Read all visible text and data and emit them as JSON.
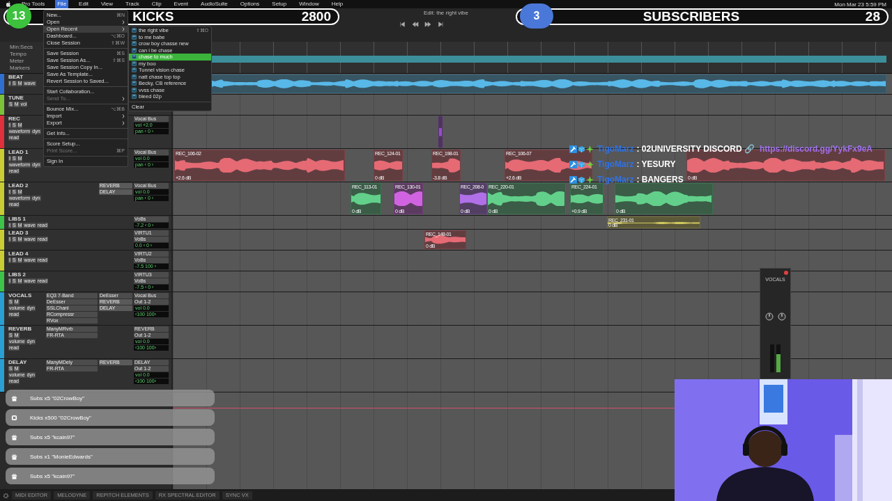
{
  "menu_bar": {
    "items": [
      {
        "label": "Pro Tools",
        "selected": false
      },
      {
        "label": "File",
        "selected": true
      },
      {
        "label": "Edit",
        "selected": false
      },
      {
        "label": "View",
        "selected": false
      },
      {
        "label": "Track",
        "selected": false
      },
      {
        "label": "Clip",
        "selected": false
      },
      {
        "label": "Event",
        "selected": false
      },
      {
        "label": "AudioSuite",
        "selected": false
      },
      {
        "label": "Options",
        "selected": false
      },
      {
        "label": "Setup",
        "selected": false
      },
      {
        "label": "Window",
        "selected": false
      },
      {
        "label": "Help",
        "selected": false
      }
    ],
    "clock": "Mon Mar 23  5:59 PM"
  },
  "window": {
    "title": "Edit: the right vibe"
  },
  "stream_counters": [
    {
      "badge": "13",
      "label": "KICKS",
      "value": "2800",
      "color": "#3cc23c"
    },
    {
      "badge": "3",
      "label": "SUBSCRIBERS",
      "value": "28",
      "color": "#4a78d8"
    }
  ],
  "file_menu": [
    {
      "kind": "item",
      "label": "New...",
      "shortcut": "⌘N",
      "submenu": false,
      "disabled": false,
      "selected": false
    },
    {
      "kind": "item",
      "label": "Open",
      "submenu": true,
      "disabled": false,
      "selected": false
    },
    {
      "kind": "item",
      "label": "Open Recent",
      "submenu": true,
      "disabled": false,
      "selected": true
    },
    {
      "kind": "item",
      "label": "Dashboard...",
      "shortcut": "⌥⌘O",
      "submenu": false,
      "disabled": false,
      "selected": false
    },
    {
      "kind": "item",
      "label": "Close Session",
      "shortcut": "⇧⌘W",
      "submenu": false,
      "disabled": false,
      "selected": false
    },
    {
      "kind": "separator"
    },
    {
      "kind": "item",
      "label": "Save Session",
      "shortcut": "⌘S",
      "submenu": false,
      "disabled": false,
      "selected": false
    },
    {
      "kind": "item",
      "label": "Save Session As...",
      "shortcut": "⇧⌘S",
      "submenu": false,
      "disabled": false,
      "selected": false
    },
    {
      "kind": "item",
      "label": "Save Session Copy In...",
      "submenu": false,
      "disabled": false,
      "selected": false
    },
    {
      "kind": "item",
      "label": "Save As Template...",
      "submenu": false,
      "disabled": false,
      "selected": false
    },
    {
      "kind": "item",
      "label": "Revert Session to Saved...",
      "submenu": false,
      "disabled": false,
      "selected": false
    },
    {
      "kind": "separator"
    },
    {
      "kind": "item",
      "label": "Start Collaboration...",
      "submenu": false,
      "disabled": false,
      "selected": false
    },
    {
      "kind": "item",
      "label": "Send To...",
      "submenu": true,
      "disabled": true,
      "selected": false
    },
    {
      "kind": "separator"
    },
    {
      "kind": "item",
      "label": "Bounce Mix...",
      "shortcut": "⌥⌘B",
      "submenu": false,
      "disabled": false,
      "selected": false
    },
    {
      "kind": "item",
      "label": "Import",
      "submenu": true,
      "disabled": false,
      "selected": false
    },
    {
      "kind": "item",
      "label": "Export",
      "submenu": true,
      "disabled": false,
      "selected": false
    },
    {
      "kind": "separator"
    },
    {
      "kind": "item",
      "label": "Get Info...",
      "submenu": false,
      "disabled": false,
      "selected": false
    },
    {
      "kind": "separator"
    },
    {
      "kind": "item",
      "label": "Score Setup...",
      "submenu": false,
      "disabled": false,
      "selected": false
    },
    {
      "kind": "item",
      "label": "Print Score...",
      "shortcut": "⌘P",
      "submenu": false,
      "disabled": true,
      "selected": false
    },
    {
      "kind": "separator"
    },
    {
      "kind": "item",
      "label": "Sign In",
      "submenu": false,
      "disabled": false,
      "selected": false
    }
  ],
  "recent_menu": {
    "items": [
      {
        "label": "the right vibe",
        "shortcut": "⇧⌘O",
        "selected": false
      },
      {
        "label": "to me babe",
        "selected": false
      },
      {
        "label": "crow boy chasse new",
        "selected": false
      },
      {
        "label": "can i be chase",
        "selected": false
      },
      {
        "label": "chase to much",
        "selected": true
      },
      {
        "label": "my boo",
        "selected": false
      },
      {
        "label": "Tunnel vision chase",
        "selected": false
      },
      {
        "label": "natt chase top top",
        "selected": false
      },
      {
        "label": "Becky, CB reference",
        "selected": false
      },
      {
        "label": "vvss chase",
        "selected": false
      },
      {
        "label": "bleed 02p",
        "selected": false
      }
    ],
    "clear": "Clear"
  },
  "rulers": [
    "Min:Secs",
    "Tempo",
    "Meter",
    "Markers"
  ],
  "tracks": [
    {
      "name": "BEAT",
      "color": "#2f6fd0",
      "kind": "medium",
      "buttons": [
        "I",
        "S",
        "M"
      ],
      "modes": [
        "wave"
      ],
      "clips": [
        {
          "color": "#58b8e8"
        }
      ]
    },
    {
      "name": "TUNE",
      "color": "#7cc13a",
      "kind": "medium",
      "buttons": [
        "S",
        "M"
      ],
      "modes": [
        "vol"
      ]
    },
    {
      "name": "REC",
      "color": "#e0303c",
      "kind": "tall",
      "buttons": [
        "I",
        "S",
        "M"
      ],
      "modes": [
        "waveform",
        "dyn",
        "read"
      ],
      "io": [
        "Vocal Bus"
      ],
      "readouts": [
        "vol +2.0",
        "pan ‹ 0 ›"
      ],
      "clips": [
        {
          "color": "#9a4ad0"
        }
      ]
    },
    {
      "name": "LEAD 1",
      "color": "#c9cc34",
      "kind": "tall",
      "buttons": [
        "I",
        "S",
        "M"
      ],
      "modes": [
        "waveform",
        "dyn",
        "read"
      ],
      "io": [
        "Vocal Bus"
      ],
      "readouts": [
        "vol 0.0",
        "pan ‹ 0 ›"
      ],
      "clips": [
        {
          "name": "REC_106-02",
          "gain": "+2.6 dB",
          "color": "#e56a74"
        },
        {
          "name": "REC_124-01",
          "gain": "0 dB",
          "color": "#e56a74"
        },
        {
          "name": "REC_198-01",
          "gain": "-3.8 dB",
          "color": "#e56a74"
        },
        {
          "name": "REC_106-07",
          "gain": "+2.6 dB",
          "color": "#e56a74"
        },
        {
          "gain": "0 dB",
          "color": "#e56a74"
        }
      ]
    },
    {
      "name": "LEAD 2",
      "color": "#c9cc34",
      "kind": "tall",
      "buttons": [
        "I",
        "S",
        "M"
      ],
      "modes": [
        "waveform",
        "dyn",
        "read"
      ],
      "sends": [
        "REVERB",
        "DELAY"
      ],
      "io": [
        "Vocal Bus"
      ],
      "readouts": [
        "vol 0.0",
        "pan ‹ 0 ›"
      ],
      "clips": [
        {
          "name": "REC_113-01",
          "gain": "0 dB",
          "color": "#62d08a"
        },
        {
          "name": "REC_130-01",
          "gain": "0 dB",
          "color": "#d064e0"
        },
        {
          "name": "REC_208-0",
          "gain": "0 dB",
          "color": "#b070e8"
        },
        {
          "name": "REC_220-01",
          "gain": "0 dB",
          "color": "#62d08a"
        },
        {
          "name": "REC_224-01",
          "gain": "+0.9 dB",
          "color": "#62d08a"
        },
        {
          "gain": "0 dB",
          "color": "#62d08a"
        }
      ]
    },
    {
      "name": "LIBS 1",
      "color": "#3ec24a",
      "kind": "short",
      "buttons": [
        "I",
        "S",
        "M"
      ],
      "modes": [
        "wave",
        "read"
      ],
      "io": [
        "VoBs"
      ],
      "readouts": [
        "-7.2 ‹ 0 ›"
      ],
      "clips": [
        {
          "name": "REC_231-01",
          "gain": "0 dB",
          "color": "#d0c860"
        }
      ]
    },
    {
      "name": "LEAD 3",
      "color": "#c9cc34",
      "kind": "medium",
      "buttons": [
        "I",
        "S",
        "M"
      ],
      "modes": [
        "wave",
        "read"
      ],
      "io": [
        "VIRTU1",
        "VoBs"
      ],
      "readouts": [
        "0.0 ‹ 0 ›"
      ],
      "clips": [
        {
          "name": "REC_148-01",
          "gain": "0 dB",
          "color": "#e56a74"
        }
      ]
    },
    {
      "name": "LEAD 4",
      "color": "#c9cc34",
      "kind": "medium",
      "buttons": [
        "I",
        "S",
        "M"
      ],
      "modes": [
        "wave",
        "read"
      ],
      "io": [
        "VIRTU2",
        "VoBs"
      ],
      "readouts": [
        "-7.5 100 ›"
      ]
    },
    {
      "name": "LIBS 2",
      "color": "#3ec24a",
      "kind": "medium",
      "buttons": [
        "I",
        "S",
        "M"
      ],
      "modes": [
        "wave",
        "read"
      ],
      "io": [
        "VIRTU3",
        "VoBs"
      ],
      "readouts": [
        "-7.5 ‹ 0 ›"
      ]
    },
    {
      "name": "VOCALS",
      "color": "#2a9fd4",
      "kind": "tall",
      "buttons": [
        "S",
        "M"
      ],
      "modes": [
        "volume",
        "dyn",
        "read"
      ],
      "inserts": [
        "EQ3 7-Band",
        "DeEsser",
        "SSLChanl",
        "RCompressr",
        "RVox"
      ],
      "inserts_b": [
        "DeEsser"
      ],
      "sends": [
        "REVERB",
        "DELAY"
      ],
      "io": [
        "Vocal Bus",
        "Out 1-2"
      ],
      "readouts": [
        "vol 0.0",
        "‹100 100›"
      ]
    },
    {
      "name": "REVERB",
      "color": "#2a9fd4",
      "kind": "tall",
      "buttons": [
        "S",
        "M"
      ],
      "modes": [
        "volume",
        "dyn",
        "read"
      ],
      "inserts": [
        "ManyMRvrb",
        "FR-RTA"
      ],
      "io": [
        "REVERB",
        "Out 1-2"
      ],
      "readouts": [
        "vol 0.0",
        "‹100 100›"
      ]
    },
    {
      "name": "DELAY",
      "color": "#2a9fd4",
      "kind": "tall",
      "buttons": [
        "S",
        "M"
      ],
      "modes": [
        "volume",
        "dyn",
        "read"
      ],
      "inserts": [
        "ManyMDely",
        "FR-RTA"
      ],
      "sends": [
        "REVERB"
      ],
      "io": [
        "DELAY",
        "Out 1-2"
      ],
      "readouts": [
        "vol 0.0",
        "‹100 100›"
      ]
    }
  ],
  "chat": [
    {
      "user": "TigoMarz",
      "message": ": 02UNIVERSITY DISCORD 🔗",
      "link": "https://discord.gg/YykFx9eA"
    },
    {
      "user": "TigoMarz",
      "message": ": YESURY"
    },
    {
      "user": "TigoMarz",
      "message": ": BANGERS"
    }
  ],
  "alerts": [
    {
      "kind": "gift",
      "text": "Subs x5 \"02CrowBoy\""
    },
    {
      "kind": "kicks",
      "text": "Kicks x500 \"02CrowBoy\""
    },
    {
      "kind": "gift",
      "text": "Subs x5 \"kcain97\""
    },
    {
      "kind": "gift",
      "text": "Subs x1 \"MonieEdwards\""
    },
    {
      "kind": "gift",
      "text": "Subs x5 \"kcain97\""
    }
  ],
  "mini_mixer": {
    "title": "VOCALS"
  },
  "bottom_bar": [
    "MIDI EDITOR",
    "MELODYNE",
    "REPITCH ELEMENTS",
    "RX SPECTRAL EDITOR",
    "SYNC VX"
  ],
  "webcam": {
    "kind": "picture"
  }
}
